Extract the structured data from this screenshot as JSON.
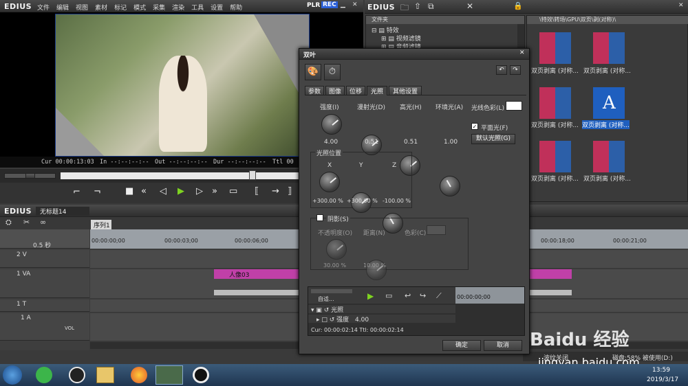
{
  "app": {
    "name": "EDIUS"
  },
  "menu": [
    "文件",
    "编辑",
    "视图",
    "素材",
    "标记",
    "模式",
    "采集",
    "渲染",
    "工具",
    "设置",
    "帮助"
  ],
  "plr": {
    "plr": "PLR",
    "rec": "REC"
  },
  "timecode": {
    "cur": "Cur 00:00:13:03",
    "in": "In --:--:--:--",
    "out": "Out --:--:--:--",
    "dur": "Dur --:--:--:--",
    "ttl": "Ttl 00"
  },
  "bin": {
    "title": "EDIUS",
    "folder_header": "文件夹",
    "tree": [
      "特效",
      "视频滤镜",
      "音频滤镜"
    ],
    "path": "\\特效\\转场\\GPU\\双页\\剥(对称)\\",
    "items": [
      "双页剥离 (对称...",
      "双页剥离 (对称...",
      "双页剥离 (对称...",
      "双页剥离 (对称...",
      "双页剥离 (对称...",
      "双页剥离 (对称..."
    ],
    "selected_index": 3
  },
  "timeline": {
    "title": "EDIUS",
    "project": "无标题14",
    "sequence": "序列1",
    "zoom": "0.5 秒",
    "ruler": [
      "00:00:00;00",
      "00:00:03;00",
      "00:00:06;00",
      "00:00:18;00",
      "00:00:21;00"
    ],
    "tracks": [
      "2 V",
      "1 VA",
      "1 T",
      "1 A"
    ],
    "vol": "VOL",
    "clip": "人像03"
  },
  "dialog": {
    "title": "双叶",
    "tabs": [
      "参数",
      "图像",
      "位移",
      "光照",
      "其他设置"
    ],
    "active_tab": "光照",
    "knobs": [
      {
        "label": "强度(I)",
        "value": "4.00"
      },
      {
        "label": "漫射光(D)",
        "value": "0.51"
      },
      {
        "label": "高光(H)",
        "value": "0.51"
      },
      {
        "label": "环境光(A)",
        "value": "1.00"
      }
    ],
    "light_color": "光线色彩(L)",
    "flat_light": "平面光(F)",
    "default_light": "默认光照(G)",
    "light_pos": "光照位置",
    "xyz": [
      {
        "label": "X",
        "value": "+300.00 %"
      },
      {
        "label": "Y",
        "value": "+300.00 %"
      },
      {
        "label": "Z",
        "value": "-100.00 %"
      }
    ],
    "shadow": "阴影(S)",
    "shadow_knobs": [
      {
        "label": "不透明度(O)",
        "value": "30.00 %"
      },
      {
        "label": "距离(N)",
        "value": "10.00 %"
      }
    ],
    "shadow_color": "色彩(C)",
    "kf_mode": "自适...",
    "kf_time": "00:00:00;00",
    "kf_rows": [
      "光照",
      "强度"
    ],
    "kf_row_value": "4.00",
    "cur_ttl": "Cur: 00:00:02:14   Ttl: 00:00:02:14",
    "ok": "确定",
    "cancel": "取消"
  },
  "status": {
    "wave": "波纹关闭",
    "disk": "磁盘:58% 被使用(D:)"
  },
  "taskbar": {
    "time": "13:59",
    "date": "2019/3/17"
  },
  "watermark": {
    "main": "Baidu 经验",
    "url": "jingyan.baidu.com"
  },
  "colors": {
    "accent": "#1f5fbf",
    "clip": "#c040a8",
    "rec": "#2a5fd8"
  }
}
